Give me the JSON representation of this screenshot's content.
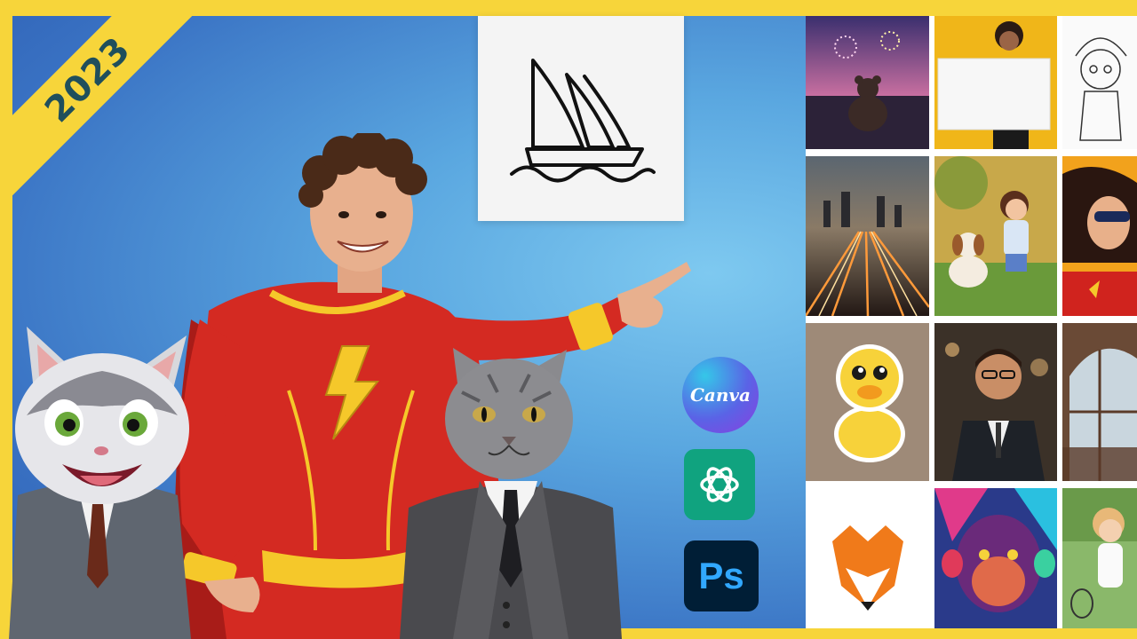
{
  "badge": {
    "year": "2023"
  },
  "logo": {
    "name": "sailboat-logo-icon"
  },
  "apps": {
    "canva_label": "Canva",
    "chatgpt_icon": "openai-knot-icon",
    "photoshop_label": "Ps"
  },
  "colors": {
    "border_yellow": "#f7d53a",
    "ribbon_text": "#1f4f5c",
    "background_blue": "#5aa7e0",
    "costume_red": "#d42a22",
    "costume_yellow": "#f5c82a",
    "chatgpt_green": "#10a37f",
    "photoshop_navy": "#001e36",
    "photoshop_blue": "#31a8ff"
  },
  "gallery": [
    {
      "name": "teddy-bear-fireworks-image"
    },
    {
      "name": "woman-holding-blank-sign-image"
    },
    {
      "name": "girl-coloring-page-image"
    },
    {
      "name": "city-highway-light-trails-image"
    },
    {
      "name": "girl-walking-dog-cartoon-image"
    },
    {
      "name": "comic-woman-sunglasses-image"
    },
    {
      "name": "duckling-sticker-image"
    },
    {
      "name": "smiling-businessman-portrait-image"
    },
    {
      "name": "arched-window-interior-image"
    },
    {
      "name": "fox-logo-image"
    },
    {
      "name": "colorful-chimpanzee-image"
    },
    {
      "name": "girl-tennis-cartoon-image"
    }
  ]
}
